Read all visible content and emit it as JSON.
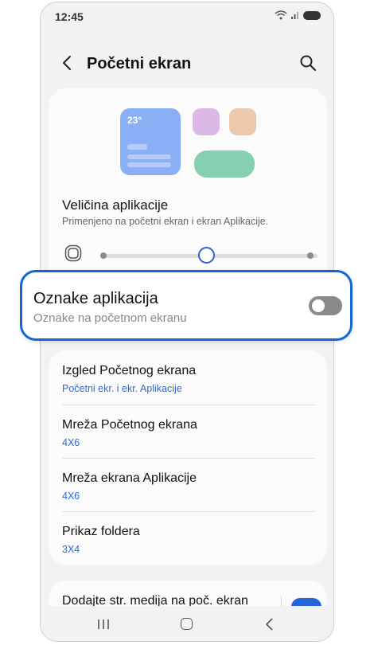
{
  "status_bar": {
    "time": "12:45"
  },
  "header": {
    "title": "Početni ekran"
  },
  "app_size": {
    "preview_temp": "23°",
    "title": "Veličina aplikacije",
    "subtitle": "Primenjeno na početni ekran i ekran Aplikacije.",
    "slider_level": 0.5
  },
  "app_labels": {
    "title": "Oznake aplikacija",
    "subtitle": "Oznake na početnom ekranu",
    "enabled": false
  },
  "settings": [
    {
      "title": "Izgled Početnog ekrana",
      "value": "Početni ekr. i ekr. Aplikacije"
    },
    {
      "title": "Mreža Početnog ekrana",
      "value": "4X6"
    },
    {
      "title": "Mreža ekrana Aplikacije",
      "value": "4X6"
    },
    {
      "title": "Prikaz foldera",
      "value": "3X4"
    }
  ],
  "media_page": {
    "title": "Dodajte str. medija na poč. ekran",
    "enabled": true
  },
  "colors": {
    "accent": "#2563d9",
    "highlight_border": "#1565d8",
    "value_text": "#2e6ad6"
  }
}
